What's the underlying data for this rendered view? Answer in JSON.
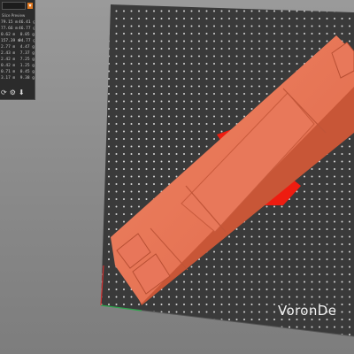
{
  "panel": {
    "title": "",
    "subtitle": "Slice Preview",
    "toggle_icon": "chevron-down-icon",
    "rows": [
      {
        "a": "79.15 m",
        "b": "46.41 g"
      },
      {
        "a": "77.66 m",
        "b": "46.77 g"
      },
      {
        "a": "0.62 m",
        "b": "0.05 g"
      },
      {
        "a": "157.39 m",
        "b": "94.77 g"
      },
      {
        "a": "2.77 m",
        "b": "4.47 g"
      },
      {
        "a": "2.43 m",
        "b": "7.37 g"
      },
      {
        "a": "2.42 m",
        "b": "7.25 g"
      },
      {
        "a": "0.42 m",
        "b": "1.25 g"
      },
      {
        "a": "0.71 m",
        "b": "0.45 g"
      },
      {
        "a": "3.17 m",
        "b": "9.38 g"
      }
    ],
    "footer_icons": [
      "orient-icon",
      "settings-icon",
      "export-icon"
    ]
  },
  "bed": {
    "label": "VoronDe",
    "color": "#3a3a3a",
    "dot_color": "#d8d8d8"
  },
  "model": {
    "color": "#e07050",
    "overhang_color": "#ee1c10"
  }
}
